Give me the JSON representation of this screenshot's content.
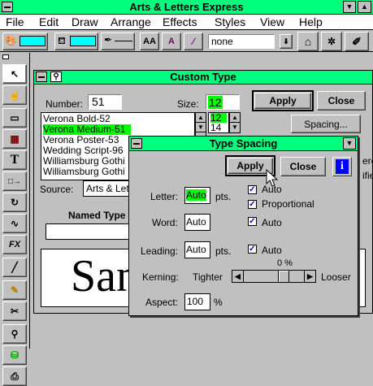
{
  "app": {
    "title": "Arts & Letters Express"
  },
  "menu": [
    "File",
    "Edit",
    "Draw",
    "Arrange",
    "Effects",
    "Styles",
    "View",
    "Help"
  ],
  "toolbar": {
    "line_style_value": "none"
  },
  "custom_type": {
    "title": "Custom Type",
    "number_label": "Number:",
    "number_value": "51",
    "size_label": "Size:",
    "size_value": "12",
    "fonts": [
      "Verona Bold-52",
      "Verona Medium-51",
      "Verona Poster-53",
      "Wedding Script-96",
      "Williamsburg Gothi",
      "Williamsburg Gothi"
    ],
    "sizes": [
      "12",
      "14"
    ],
    "apply_label": "Apply",
    "close_label": "Close",
    "spacing_label": "Spacing...",
    "source_label": "Source:",
    "source_value": "Arts & Lette",
    "named_type_label": "Named Type",
    "preview_text": "San",
    "side_text_1": "ere",
    "side_text_2": "ified",
    "side_text_3": "e"
  },
  "type_spacing": {
    "title": "Type Spacing",
    "apply_label": "Apply",
    "close_label": "Close",
    "info_label": "i",
    "letter_label": "Letter:",
    "letter_value": "Auto",
    "word_label": "Word:",
    "word_value": "Auto",
    "leading_label": "Leading:",
    "leading_value": "Auto",
    "pts": "pts.",
    "auto_label": "Auto",
    "proportional_label": "Proportional",
    "kerning_label": "Kerning:",
    "tighter_label": "Tighter",
    "looser_label": "Looser",
    "kerning_value": "0 %",
    "aspect_label": "Aspect:",
    "aspect_value": "100",
    "percent": "%"
  },
  "colors": {
    "titlebar": "#00ff7f",
    "selection": "#00ff00",
    "swatch": "#00ffff",
    "info": "#0000ff"
  }
}
